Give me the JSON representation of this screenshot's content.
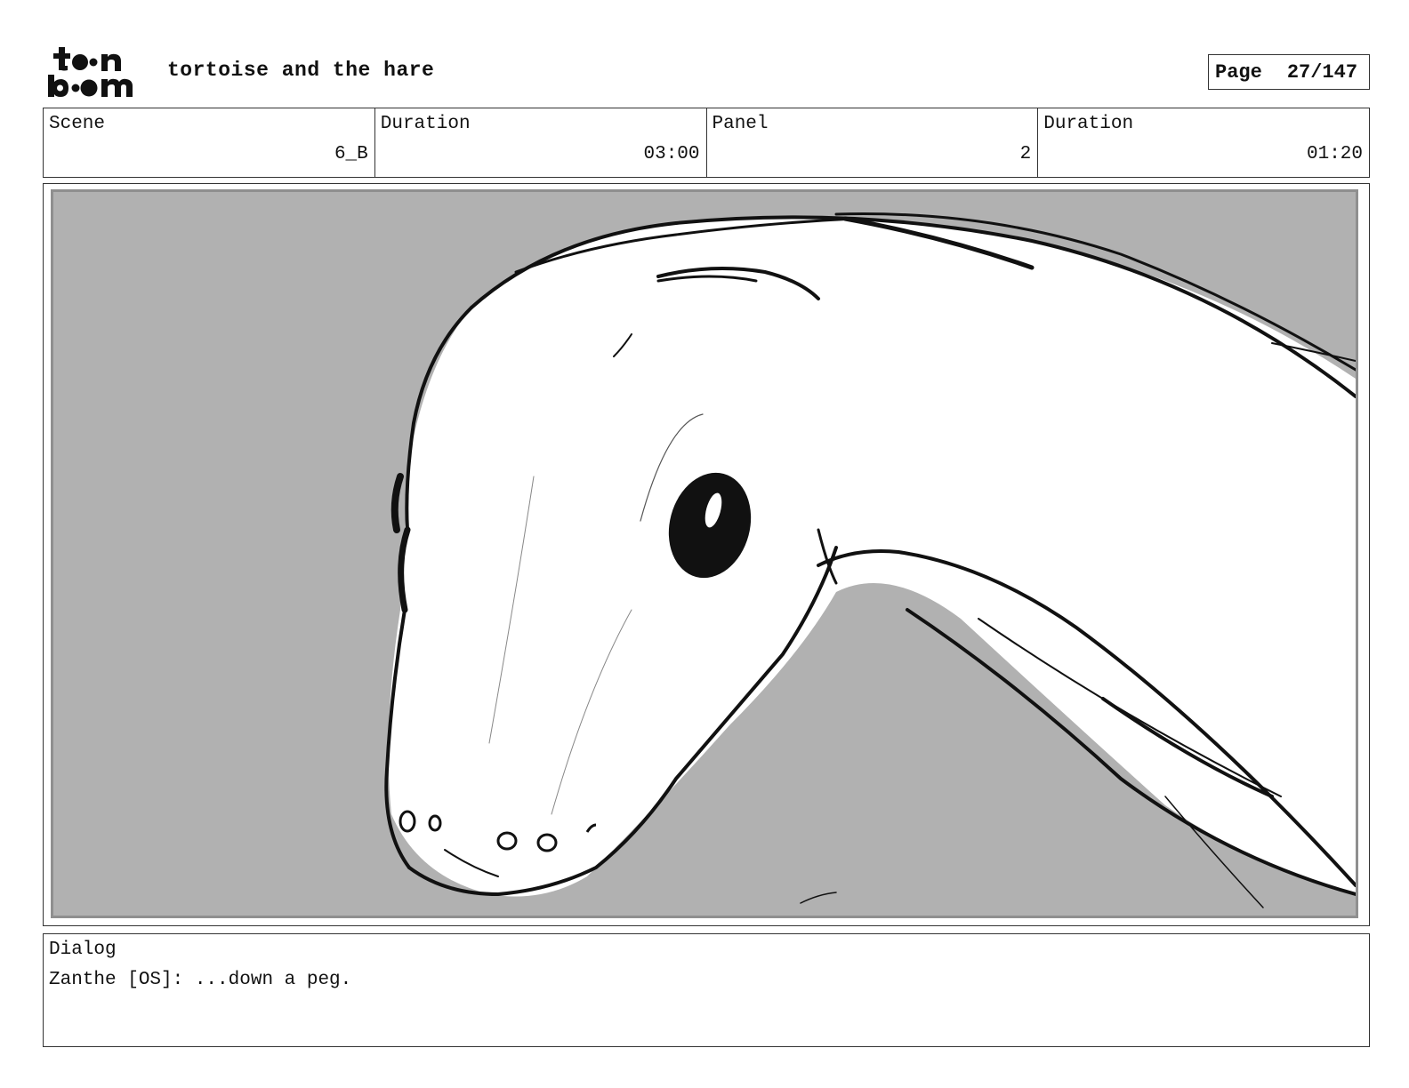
{
  "header": {
    "logo_text": "toon boom",
    "project_title": "tortoise and the hare",
    "page_label": "Page",
    "page_value": "27/147"
  },
  "info": {
    "scene_label": "Scene",
    "scene_value": "6_B",
    "scene_duration_label": "Duration",
    "scene_duration_value": "03:00",
    "panel_label": "Panel",
    "panel_value": "2",
    "panel_duration_label": "Duration",
    "panel_duration_value": "01:20"
  },
  "panel": {
    "background_color": "#b1b1b1",
    "subject_icon": "long-neck-creature-sketch"
  },
  "dialog": {
    "label": "Dialog",
    "text": "Zanthe [OS]: ...down a peg."
  }
}
